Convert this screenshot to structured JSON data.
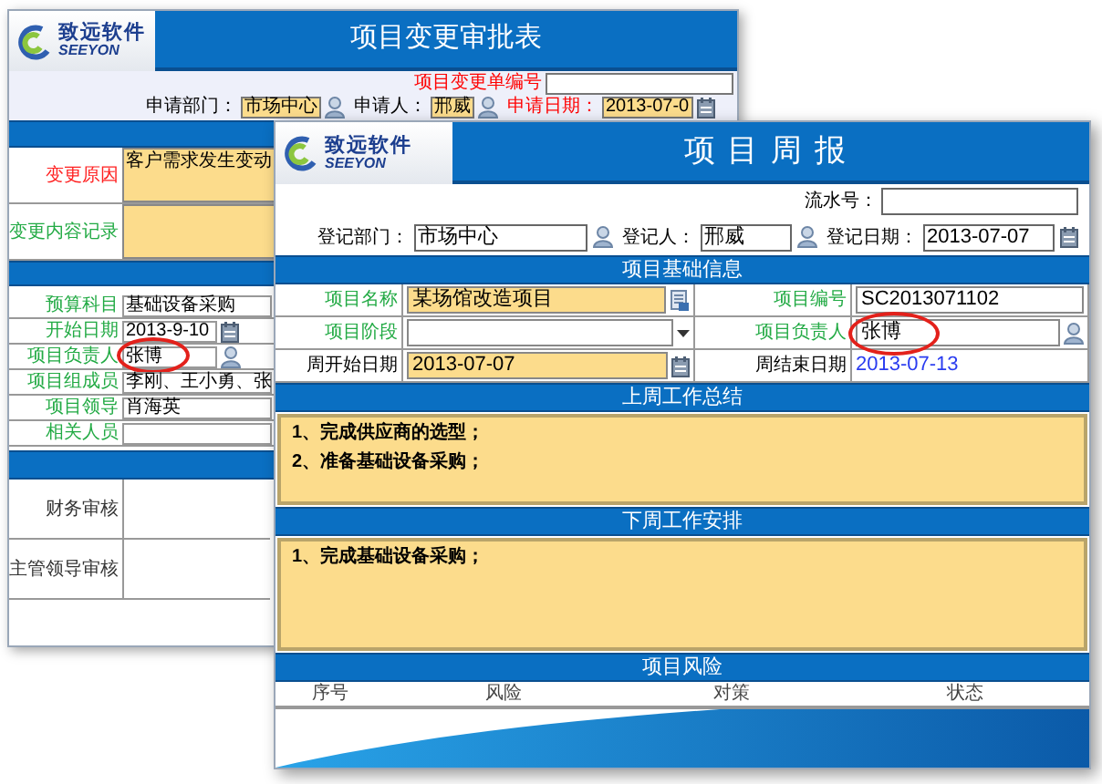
{
  "back_form": {
    "logo": {
      "name": "致远软件",
      "brand": "SEEYON"
    },
    "title": "项目变更审批表",
    "serial": {
      "label": "项目变更单编号",
      "color": "#ff0000"
    },
    "apply_fields": [
      {
        "label": "申请部门：",
        "color": "#000000",
        "value": "市场中心",
        "kind": "person"
      },
      {
        "label": "申请人：",
        "color": "#000000",
        "value": "邢威",
        "kind": "person"
      },
      {
        "label": "申请日期：",
        "color": "#ff0000",
        "value": "2013-07-0",
        "kind": "date"
      }
    ],
    "change_rows": [
      {
        "label": "变更原因",
        "color": "#ff2020",
        "value": "客户需求发生变动"
      },
      {
        "label": "变更内容记录",
        "color": "#22aa44"
      }
    ],
    "info_rows": [
      {
        "label": "预算科目",
        "color": "#22aa44",
        "value": "基础设备采购",
        "kind": "text",
        "circled": false
      },
      {
        "label": "开始日期",
        "color": "#22aa44",
        "value": "2013-9-10",
        "kind": "date",
        "circled": false
      },
      {
        "label": "项目负责人",
        "color": "#22aa44",
        "value": "张博",
        "kind": "person",
        "circled": true
      },
      {
        "label": "项目组成员",
        "color": "#22aa44",
        "value": "李刚、王小勇、张",
        "kind": "text",
        "circled": false
      },
      {
        "label": "项目领导",
        "color": "#22aa44",
        "value": "肖海英",
        "kind": "text",
        "circled": false
      },
      {
        "label": "相关人员",
        "color": "#22aa44",
        "kind": "text",
        "circled": false
      }
    ],
    "approval_rows": [
      {
        "label": "财务审核"
      },
      {
        "label": "主管领导审核"
      }
    ]
  },
  "front_form": {
    "logo": {
      "name": "致远软件",
      "brand": "SEEYON"
    },
    "title": "项目周报",
    "serial": {
      "label": "流水号："
    },
    "register_fields": [
      {
        "label": "登记部门：",
        "value": "市场中心",
        "kind": "person"
      },
      {
        "label": "登记人：",
        "value": "邢威",
        "kind": "person"
      },
      {
        "label": "登记日期：",
        "value": "2013-07-07",
        "kind": "date"
      }
    ],
    "sections": [
      {
        "title": "项目基础信息",
        "kind": "fields",
        "rows": [
          [
            {
              "label": "项目名称",
              "color": "#22aa44",
              "value": "某场馆改造项目",
              "kind": "lookup",
              "highlighted": true,
              "circled": false
            },
            {
              "label": "项目编号",
              "color": "#22aa44",
              "value": "SC2013071102",
              "kind": "text",
              "highlighted": false,
              "circled": false
            }
          ],
          [
            {
              "label": "项目阶段",
              "color": "#22aa44",
              "kind": "select",
              "highlighted": false,
              "circled": false
            },
            {
              "label": "项目负责人",
              "color": "#22aa44",
              "value": "张博",
              "kind": "person",
              "highlighted": false,
              "circled": true
            }
          ],
          [
            {
              "label": "周开始日期",
              "color": "#000000",
              "value": "2013-07-07",
              "kind": "date",
              "highlighted": true,
              "circled": false
            },
            {
              "label": "周结束日期",
              "color": "#000000",
              "value": "2013-07-13",
              "kind": "display",
              "circled": false
            }
          ]
        ]
      },
      {
        "title": "上周工作总结",
        "kind": "notes",
        "lines": [
          "1、完成供应商的选型；",
          "2、准备基础设备采购；"
        ]
      },
      {
        "title": "下周工作安排",
        "kind": "notes",
        "lines": [
          "1、完成基础设备采购；"
        ]
      },
      {
        "title": "项目风险",
        "kind": "table",
        "columns": [
          "序号",
          "风险",
          "对策",
          "状态"
        ]
      }
    ]
  }
}
